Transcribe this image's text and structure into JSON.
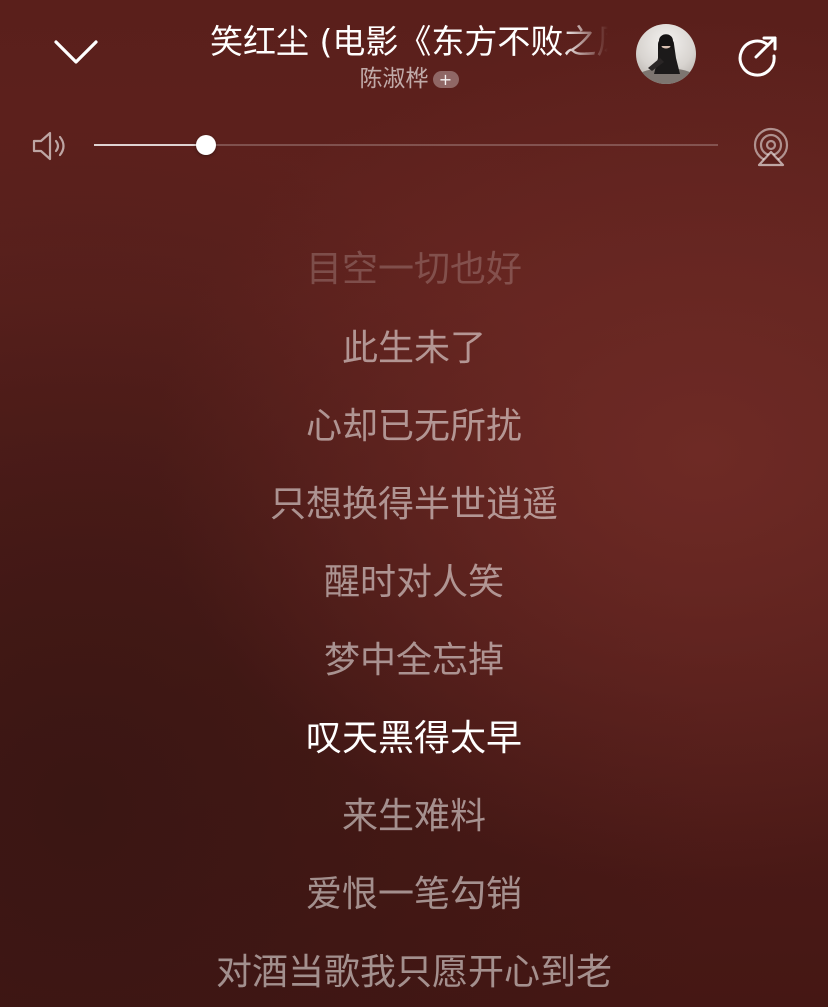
{
  "player": {
    "title": "笑红尘 (电影《东方不败之风云再起》主题曲)",
    "artist": "陈淑桦",
    "follow_badge": "+",
    "volume": 0.18
  },
  "icons": {
    "collapse": "chevron-down-icon",
    "share": "share-icon",
    "volume": "speaker-icon",
    "airplay": "airplay-icon"
  },
  "lyrics": {
    "current_index": 6,
    "lines": [
      "目空一切也好",
      "此生未了",
      "心却已无所扰",
      "只想换得半世逍遥",
      "醒时对人笑",
      "梦中全忘掉",
      "叹天黑得太早",
      "来生难料",
      "爱恨一笔勾销",
      "对酒当歌我只愿开心到老"
    ]
  }
}
